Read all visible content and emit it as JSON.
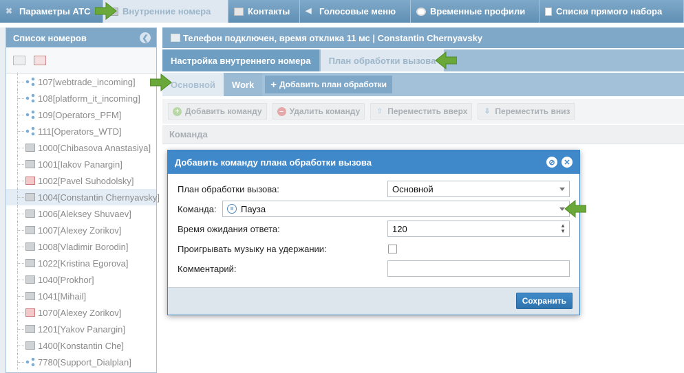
{
  "topnav": {
    "tabs": [
      {
        "label": "Параметры АТС",
        "icon": "wrench-icon"
      },
      {
        "label": "Внутренние номера",
        "icon": "phone-icon"
      },
      {
        "label": "Контакты",
        "icon": "book-icon"
      },
      {
        "label": "Голосовые меню",
        "icon": "speaker-icon"
      },
      {
        "label": "Временные профили",
        "icon": "clock-icon"
      },
      {
        "label": "Списки прямого набора",
        "icon": "list-icon"
      }
    ]
  },
  "sidebar": {
    "title": "Список номеров",
    "items": [
      {
        "label": "107[webtrade_incoming]",
        "icon": "share-icon"
      },
      {
        "label": "108[platform_it_incoming]",
        "icon": "share-icon"
      },
      {
        "label": "109[Operators_PFM]",
        "icon": "share-icon"
      },
      {
        "label": "111[Operators_WTD]",
        "icon": "share-icon"
      },
      {
        "label": "1000[Chibasova Anastasiya]",
        "icon": "phone-icon"
      },
      {
        "label": "1001[Iakov Panargin]",
        "icon": "phone-icon"
      },
      {
        "label": "1002[Pavel Suhodolsky]",
        "icon": "phone-red-icon"
      },
      {
        "label": "1004[Constantin Chernyavsky]",
        "icon": "phone-icon"
      },
      {
        "label": "1006[Aleksey Shuvaev]",
        "icon": "phone-icon"
      },
      {
        "label": "1007[Alexey Zorikov]",
        "icon": "phone-icon"
      },
      {
        "label": "1008[Vladimir Borodin]",
        "icon": "phone-icon"
      },
      {
        "label": "1022[Kristina Egorova]",
        "icon": "phone-icon"
      },
      {
        "label": "1040[Prokhor]",
        "icon": "phone-icon"
      },
      {
        "label": "1041[Mihail]",
        "icon": "phone-icon"
      },
      {
        "label": "1070[Alexey Zorikov]",
        "icon": "phone-red-icon"
      },
      {
        "label": "1201[Yakov Panargin]",
        "icon": "phone-icon"
      },
      {
        "label": "1400[Konstantin Che]",
        "icon": "phone-icon"
      },
      {
        "label": "7780[Support_Dialplan]",
        "icon": "share-icon"
      }
    ]
  },
  "main": {
    "status": "Телефон подключен, время отклика 11 мс | Constantin Chernyavsky",
    "subtabs": [
      "Настройка внутреннего номера",
      "План обработки вызова"
    ],
    "plantabs": [
      "Основной",
      "Work"
    ],
    "add_plan_label": "Добавить план обработки",
    "commands": {
      "add": "Добавить команду",
      "delete": "Удалить команду",
      "up": "Переместить вверх",
      "down": "Переместить вниз"
    },
    "grid_header": "Команда"
  },
  "dialog": {
    "title": "Добавить команду плана обработки вызова",
    "plan_label": "План обработки вызова:",
    "plan_value": "Основной",
    "command_label": "Команда:",
    "command_value": "Пауза",
    "wait_label": "Время ожидания ответа:",
    "wait_value": "120",
    "music_label": "Проигрывать музыку на удержании:",
    "comment_label": "Комментарий:",
    "comment_value": "",
    "save_label": "Сохранить"
  },
  "colors": {
    "accent": "#3f88ca",
    "header": "#7ea7c8",
    "arrow": "#6aa83a"
  }
}
